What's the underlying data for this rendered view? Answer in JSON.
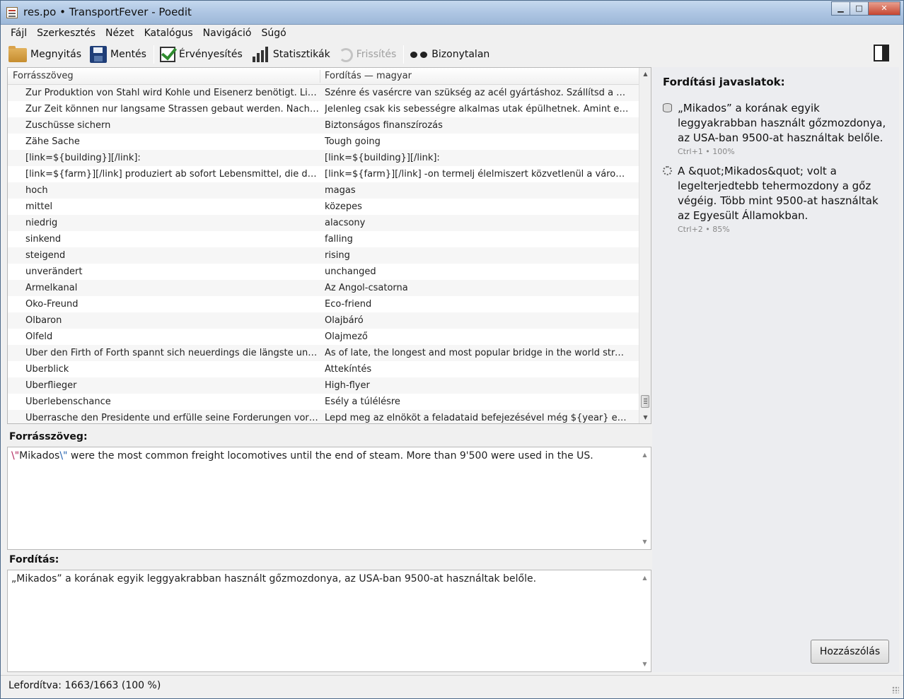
{
  "window": {
    "title": "res.po • TransportFever - Poedit",
    "minimize": "▁",
    "maximize": "□",
    "close": "✕"
  },
  "menu": [
    {
      "label": "Fájl"
    },
    {
      "label": "Szerkesztés"
    },
    {
      "label": "Nézet"
    },
    {
      "label": "Katalógus"
    },
    {
      "label": "Navigáció"
    },
    {
      "label": "Súgó"
    }
  ],
  "toolbar": {
    "open": "Megnyitás",
    "save": "Mentés",
    "validate": "Érvényesítés",
    "stats": "Statisztikák",
    "refresh": "Frissítés",
    "fuzzy": "Bizonytalan"
  },
  "list": {
    "col_source": "Forrásszöveg",
    "col_translation": "Fordítás — magyar",
    "rows": [
      {
        "src": "Zur Produktion von Stahl wird Kohle und Eisenerz benötigt. Liefere...",
        "tr": "Szénre és vasércre van szükség az acél gyártáshoz. Szállítsd a szüksé..."
      },
      {
        "src": "Zur Zeit können nur langsame Strassen gebaut werden. Nach Abs...",
        "tr": "Jelenleg csak kis sebességre alkalmas utak épülhetnek. Amint ezt a k..."
      },
      {
        "src": "Zuschüsse sichern",
        "tr": "Biztonságos finanszírozás"
      },
      {
        "src": "Zähe Sache",
        "tr": "Tough going"
      },
      {
        "src": "[link=${building}][/link]:",
        "tr": "[link=${building}][/link]:"
      },
      {
        "src": "[link=${farm}][/link] produziert ab sofort Lebensmittel, die direkt in...",
        "tr": "[link=${farm}][/link] -on termelj élelmiszert közvetlenül a városok rész..."
      },
      {
        "src": "hoch",
        "tr": "magas"
      },
      {
        "src": "mittel",
        "tr": "közepes"
      },
      {
        "src": "niedrig",
        "tr": "alacsony"
      },
      {
        "src": "sinkend",
        "tr": "falling"
      },
      {
        "src": "steigend",
        "tr": "rising"
      },
      {
        "src": "unverändert",
        "tr": "unchanged"
      },
      {
        "src": "Ärmelkanal",
        "tr": "Az Angol-csatorna"
      },
      {
        "src": "Öko-Freund",
        "tr": "Eco-friend"
      },
      {
        "src": "Ölbaron",
        "tr": "Olajbáró"
      },
      {
        "src": "Ölfeld",
        "tr": "Olajmező"
      },
      {
        "src": "Über den Firth of Forth spannt sich neuerdings die längste und be...",
        "tr": "As of late, the longest and most popular bridge in the world stretche..."
      },
      {
        "src": "Überblick",
        "tr": "Áttekíntés"
      },
      {
        "src": "Überflieger",
        "tr": "High-flyer"
      },
      {
        "src": "Überlebenschance",
        "tr": "Esély a túlélésre"
      },
      {
        "src": "Überrasche den Presidente und erfülle seine Forderungen vor ${ye...",
        "tr": "Lepd meg az elnököt a feladataid befejezésével még ${year} előtt."
      }
    ]
  },
  "source_pane": {
    "label": "Forrásszöveg:",
    "esc_open": "\\\"",
    "word": "Mikados",
    "esc_close": "\\\"",
    "rest": " were the most common freight locomotives until the end of steam. More than 9'500 were used in the US."
  },
  "translation_pane": {
    "label": "Fordítás:",
    "text": "„Mikados” a korának egyik leggyakrabban használt gőzmozdonya, az USA-ban 9500-at használtak belőle."
  },
  "sidebar": {
    "heading": "Fordítási javaslatok:",
    "suggestions": [
      {
        "text": "„Mikados” a korának egyik leggyakrabban használt gőzmozdonya, az USA-ban 9500-at használtak belőle.",
        "meta": "Ctrl+1 • 100%",
        "icon": "database-icon"
      },
      {
        "text": "A &quot;Mikados&quot; volt a legelterjedtebb tehermozdony a gőz végéig. Több mint 9500-at használtak az Egyesült Államokban.",
        "meta": "Ctrl+2 • 85%",
        "icon": "gear-icon"
      }
    ],
    "comment_button": "Hozzászólás"
  },
  "status": {
    "text": "Lefordítva: 1663/1663 (100 %)"
  }
}
